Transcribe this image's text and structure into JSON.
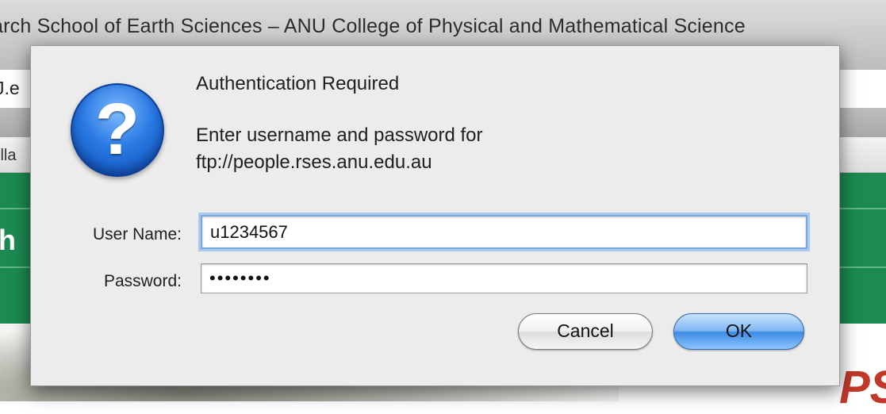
{
  "window": {
    "title": "arch School of Earth Sciences – ANU College of Physical and Mathematical Science",
    "url_fragment": "J.e",
    "bookmark_fragment": "illa",
    "banner_fragment": "h",
    "logo_fragment": "PS"
  },
  "dialog": {
    "icon": "question-mark-icon",
    "title": "Authentication Required",
    "message_line1": "Enter username and password for",
    "message_line2": "ftp://people.rses.anu.edu.au",
    "username_label": "User Name:",
    "username_value": "u1234567",
    "password_label": "Password:",
    "password_value": "••••••••",
    "cancel_label": "Cancel",
    "ok_label": "OK"
  },
  "colors": {
    "banner_green": "#1d8a52",
    "ok_button_blue": "#3d8be3",
    "focus_ring": "#7aa9e0"
  }
}
